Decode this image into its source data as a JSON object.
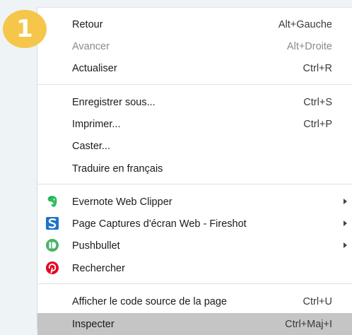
{
  "step": {
    "number": "1",
    "color": "#f5c64a"
  },
  "menu": {
    "groups": [
      [
        {
          "label": "Retour",
          "shortcut": "Alt+Gauche"
        },
        {
          "label": "Avancer",
          "shortcut": "Alt+Droite",
          "disabled": true
        },
        {
          "label": "Actualiser",
          "shortcut": "Ctrl+R"
        }
      ],
      [
        {
          "label": "Enregistrer sous...",
          "shortcut": "Ctrl+S"
        },
        {
          "label": "Imprimer...",
          "shortcut": "Ctrl+P"
        },
        {
          "label": "Caster..."
        },
        {
          "label": "Traduire en français"
        }
      ],
      [
        {
          "label": "Evernote Web Clipper",
          "icon": "evernote-icon",
          "submenu": true
        },
        {
          "label": "Page Captures d'écran Web - Fireshot",
          "icon": "fireshot-icon",
          "submenu": true
        },
        {
          "label": "Pushbullet",
          "icon": "pushbullet-icon",
          "submenu": true
        },
        {
          "label": "Rechercher",
          "icon": "pinterest-icon"
        }
      ],
      [
        {
          "label": "Afficher le code source de la page",
          "shortcut": "Ctrl+U"
        },
        {
          "label": "Inspecter",
          "shortcut": "Ctrl+Maj+I",
          "selected": true
        }
      ]
    ]
  }
}
